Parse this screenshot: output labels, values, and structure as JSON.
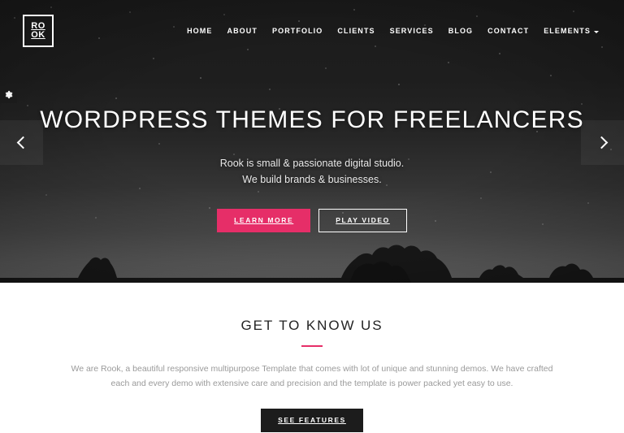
{
  "header": {
    "logo": {
      "line1": "RO",
      "line2": "OK",
      "alt": "Rook logo"
    },
    "nav": [
      {
        "label": "HOME",
        "active": true,
        "dropdown": false
      },
      {
        "label": "ABOUT",
        "active": false,
        "dropdown": false
      },
      {
        "label": "PORTFOLIO",
        "active": false,
        "dropdown": false
      },
      {
        "label": "CLIENTS",
        "active": false,
        "dropdown": false
      },
      {
        "label": "SERVICES",
        "active": false,
        "dropdown": false
      },
      {
        "label": "BLOG",
        "active": false,
        "dropdown": false
      },
      {
        "label": "CONTACT",
        "active": false,
        "dropdown": false
      },
      {
        "label": "ELEMENTS",
        "active": false,
        "dropdown": true
      }
    ]
  },
  "hero": {
    "title": "WORDPRESS THEMES FOR FREELANCERS",
    "subtitle_line1": "Rook is small & passionate digital studio.",
    "subtitle_line2": "We build brands & businesses.",
    "primary_button": "LEARN MORE",
    "secondary_button": "PLAY VIDEO",
    "prev_arrow_icon": "chevron-left-icon",
    "next_arrow_icon": "chevron-right-icon",
    "settings_icon": "gear-icon"
  },
  "about": {
    "title": "GET TO KNOW US",
    "paragraph": "We are Rook, a beautiful responsive multipurpose Template that comes with lot of unique and stunning demos. We have crafted each and every demo with extensive care and precision and the template is power packed yet easy to use.",
    "button": "SEE FEATURES"
  },
  "colors": {
    "accent_pink": "#e62e68",
    "dark": "#1c1c1c",
    "hero_bg": "#1e1e1e",
    "body_text": "#9a9a9a",
    "heading": "#232323",
    "white": "#ffffff"
  }
}
